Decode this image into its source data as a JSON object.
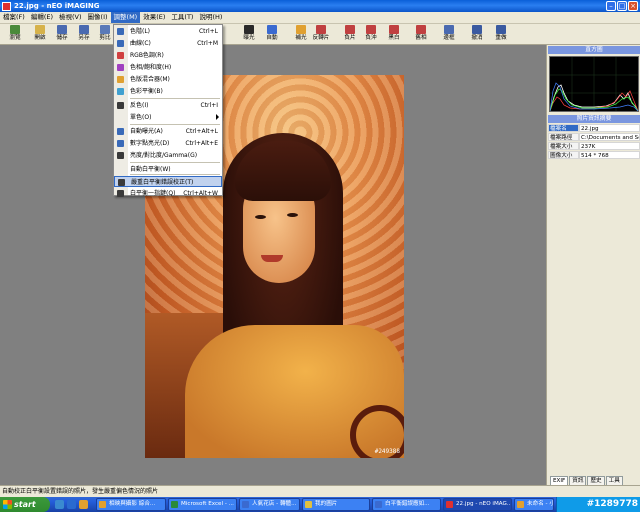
{
  "window": {
    "title": "22.jpg - nEO iMAGING"
  },
  "menubar": [
    "檔案(F)",
    "編輯(E)",
    "檢視(V)",
    "圖像(I)",
    "調整(M)",
    "效果(E)",
    "工具(T)",
    "說明(H)"
  ],
  "toolbar": [
    {
      "label": "瀏覽",
      "icon": "browse-icon",
      "color": "#4a8a3a"
    },
    {
      "label": "開啟",
      "icon": "open-folder-icon",
      "color": "#d6b24a"
    },
    {
      "label": "儲存",
      "icon": "save-icon",
      "color": "#4a6ab0"
    },
    {
      "label": "另存",
      "icon": "save-as-icon",
      "color": "#4a6ab0"
    },
    {
      "label": "剪比",
      "icon": "compare-icon",
      "color": "#5a7ab8"
    },
    {
      "label": "曝光",
      "icon": "exposure-icon",
      "color": "#2a2a2a"
    },
    {
      "label": "自動",
      "icon": "auto-icon",
      "color": "#3a6ad0"
    },
    {
      "label": "補光",
      "icon": "fill-light-icon",
      "color": "#e0a030"
    },
    {
      "label": "反轉片",
      "icon": "reversal-film-icon",
      "color": "#c04040"
    },
    {
      "label": "負片",
      "icon": "negative-icon",
      "color": "#c04040"
    },
    {
      "label": "負沖",
      "icon": "cross-process-icon",
      "color": "#c04040"
    },
    {
      "label": "黑白",
      "icon": "black-white-icon",
      "color": "#c04040"
    },
    {
      "label": "舊相",
      "icon": "old-photo-icon",
      "color": "#c04040"
    },
    {
      "label": "邊框",
      "icon": "frame-icon",
      "color": "#4a6ab0"
    },
    {
      "label": "撤消",
      "icon": "undo-icon",
      "color": "#3a5aa0"
    },
    {
      "label": "重做",
      "icon": "redo-icon",
      "color": "#3a5aa0"
    }
  ],
  "dropdown": {
    "items": [
      {
        "label": "色階(L)",
        "shortcut": "Ctrl+L",
        "icon": "levels-icon",
        "color": "#3a6ab8"
      },
      {
        "label": "曲線(C)",
        "shortcut": "Ctrl+M",
        "icon": "curves-icon",
        "color": "#3a6ab8"
      },
      {
        "label": "RGB色調(R)",
        "shortcut": "",
        "icon": "rgb-icon",
        "color": "#d04040"
      },
      {
        "label": "色相/飽和度(H)",
        "shortcut": "",
        "icon": "hue-saturation-icon",
        "color": "#a040c0"
      },
      {
        "label": "色版混合器(M)",
        "shortcut": "",
        "icon": "channel-mixer-icon",
        "color": "#e0a030"
      },
      {
        "label": "色彩平衡(B)",
        "shortcut": "",
        "icon": "color-balance-icon",
        "color": "#40a0d0"
      },
      {
        "label": "反色(I)",
        "shortcut": "Ctrl+I",
        "icon": "invert-icon",
        "color": "#3a3a3a"
      },
      {
        "label": "單色(O)",
        "shortcut": "",
        "icon": "",
        "color": ""
      },
      {
        "label": "自動曝光(A)",
        "shortcut": "Ctrl+Alt+L",
        "icon": "auto-exposure-icon",
        "color": "#3a6ab8"
      },
      {
        "label": "數字點亮光(D)",
        "shortcut": "Ctrl+Alt+E",
        "icon": "digital-flash-icon",
        "color": "#3a6ab8"
      },
      {
        "label": "亮度/對比度/Gamma(G)",
        "shortcut": "",
        "icon": "brightness-contrast-icon",
        "color": "#3a3a3a"
      },
      {
        "label": "自動白平衡(W)",
        "shortcut": "",
        "icon": "",
        "color": ""
      },
      {
        "label": "嚴重白平衡錯誤校正(T)",
        "shortcut": "",
        "icon": "white-balance-fix-icon",
        "color": "#3a3a3a"
      },
      {
        "label": "白平衡一指鍵(Q)",
        "shortcut": "Ctrl+Alt+W",
        "icon": "white-balance-picker-icon",
        "color": "#3a3a3a"
      }
    ]
  },
  "photo": {
    "watermark": "#249388"
  },
  "histogram_panel": {
    "title": "直方圖"
  },
  "info_panel": {
    "title": "照片資訊摘要",
    "rows": [
      {
        "key": "檔案名",
        "value": "22.jpg"
      },
      {
        "key": "檔案路徑",
        "value": "C:\\Documents and Setting"
      },
      {
        "key": "檔案大小",
        "value": "237K"
      },
      {
        "key": "圖像大小",
        "value": "514 * 768"
      }
    ]
  },
  "panel_tabs": [
    "EXIF",
    "資訊",
    "歷史",
    "工具"
  ],
  "statusbar": {
    "text": "自動校正白平衡設置錯誤的照片，發生嚴重偏色情況的照片"
  },
  "taskbar": {
    "start": "start",
    "tasks": [
      {
        "label": "相映與攝影 綜合...",
        "color": "#e0a030"
      },
      {
        "label": "Microsoft Excel - ...",
        "color": "#2a8a3a"
      },
      {
        "label": "人氣花店 - 轉體...",
        "color": "#3a6ad0"
      },
      {
        "label": "我的圖片",
        "color": "#e0c040"
      },
      {
        "label": "白平衡錯誤應如...",
        "color": "#3a6ad0"
      },
      {
        "label": "22.jpg - nEO iMAG...",
        "color": "#e03030"
      },
      {
        "label": "未命名 - 小畫家",
        "color": "#e0a030"
      }
    ],
    "tray_text": "#1289778"
  }
}
